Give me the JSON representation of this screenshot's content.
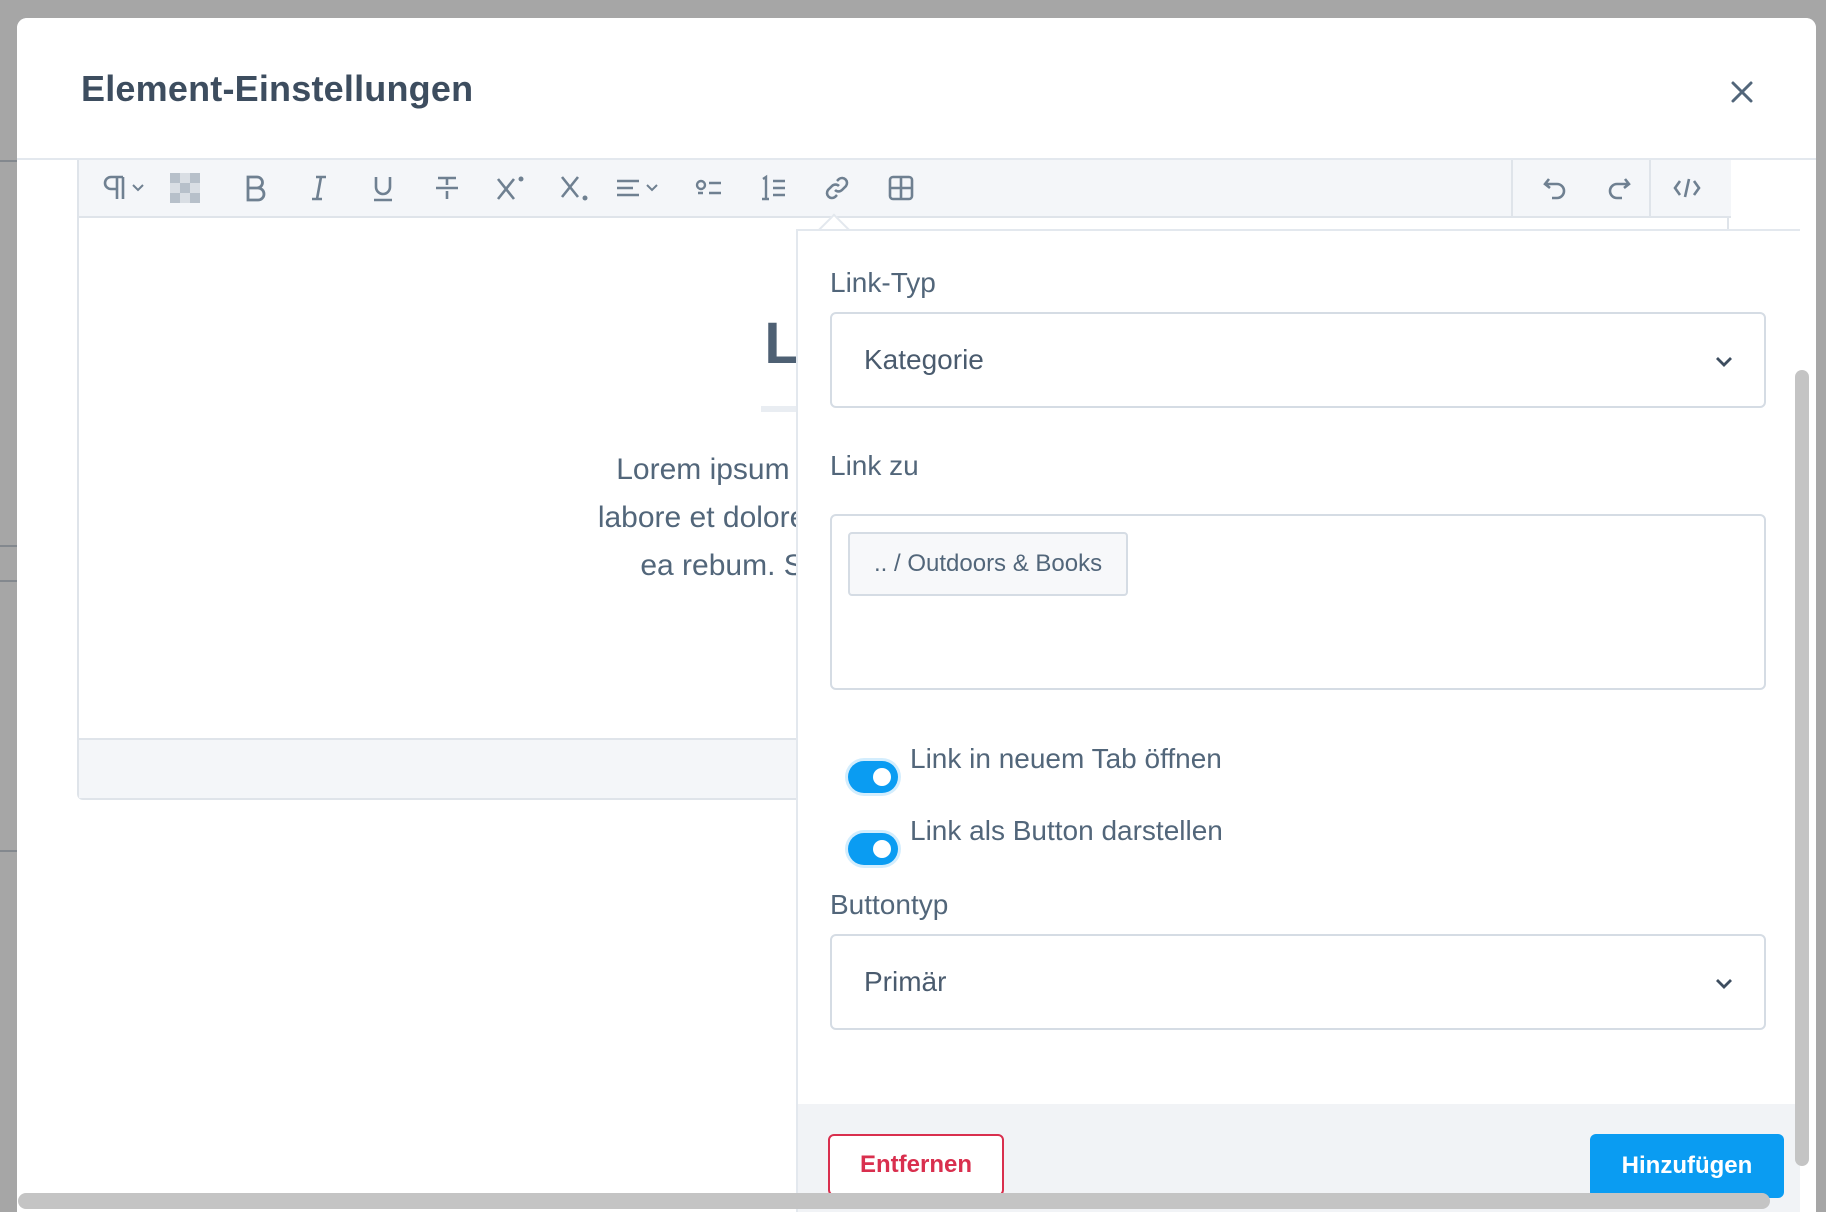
{
  "modal": {
    "title": "Element-Einstellungen",
    "close_icon": "close-icon"
  },
  "toolbar": {
    "buttons": [
      {
        "name": "paragraph-format",
        "icon": "pilcrow-icon"
      },
      {
        "name": "color",
        "icon": "checker-icon"
      },
      {
        "name": "bold",
        "icon": "bold-icon"
      },
      {
        "name": "italic",
        "icon": "italic-icon"
      },
      {
        "name": "underline",
        "icon": "underline-icon"
      },
      {
        "name": "strikethrough",
        "icon": "strikethrough-icon"
      },
      {
        "name": "superscript",
        "icon": "superscript-icon"
      },
      {
        "name": "subscript",
        "icon": "subscript-icon"
      },
      {
        "name": "align",
        "icon": "align-icon"
      },
      {
        "name": "unordered-list",
        "icon": "list-ul-icon"
      },
      {
        "name": "ordered-list",
        "icon": "list-ol-icon"
      },
      {
        "name": "link",
        "icon": "link-icon"
      },
      {
        "name": "table",
        "icon": "table-icon"
      },
      {
        "name": "undo",
        "icon": "undo-icon"
      },
      {
        "name": "redo",
        "icon": "redo-icon"
      },
      {
        "name": "code-view",
        "icon": "code-icon"
      }
    ]
  },
  "editor": {
    "heading": "Lorem Ips",
    "paragraph_line1": "Lorem ipsum dolor sit amet, consetetur sac",
    "paragraph_line2": "labore et dolore magna aliquyam erat, sed dia",
    "paragraph_line3": "ea rebum. Stet clita kasd gubergren, no"
  },
  "link_popover": {
    "link_type_label": "Link-Typ",
    "link_type_value": "Kategorie",
    "link_to_label": "Link zu",
    "link_to_tag": ".. / Outdoors & Books",
    "new_tab_label": "Link in neuem Tab öffnen",
    "new_tab_enabled": true,
    "as_button_label": "Link als Button darstellen",
    "as_button_enabled": true,
    "button_type_label": "Buttontyp",
    "button_type_value": "Primär",
    "remove_label": "Entfernen",
    "add_label": "Hinzufügen"
  },
  "colors": {
    "primary": "#0a9cf2",
    "danger": "#d92f4e",
    "text": "#52667a"
  }
}
